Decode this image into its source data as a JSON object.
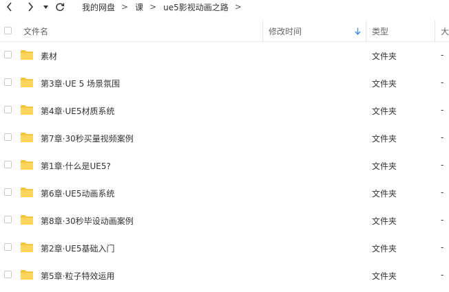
{
  "toolbar": {
    "back_icon": "chevron-left-icon",
    "forward_icon": "chevron-right-icon",
    "history_icon": "caret-down-icon",
    "refresh_icon": "refresh-icon"
  },
  "breadcrumb": {
    "items": [
      "我的网盘",
      "课",
      "ue5影视动画之路"
    ],
    "separator": ">"
  },
  "columns": {
    "name": "文件名",
    "modified": "修改时间",
    "type": "类型",
    "size": "大"
  },
  "sort": {
    "column": "modified",
    "direction": "descending",
    "icon": "sort-down-arrow-icon",
    "color": "#3b8cf7"
  },
  "folder_color": "#ffd45c",
  "files": [
    {
      "name": "素材",
      "type": "文件夹",
      "size": "-"
    },
    {
      "name": "第3章·UE 5 场景氛围",
      "type": "文件夹",
      "size": "-"
    },
    {
      "name": "第4章·UE5材质系统",
      "type": "文件夹",
      "size": "-"
    },
    {
      "name": "第7章·30秒买量视频案例",
      "type": "文件夹",
      "size": "-"
    },
    {
      "name": "第1章·什么是UE5?",
      "type": "文件夹",
      "size": "-"
    },
    {
      "name": "第6章·UE5动画系统",
      "type": "文件夹",
      "size": "-"
    },
    {
      "name": "第8章·30秒毕设动画案例",
      "type": "文件夹",
      "size": "-"
    },
    {
      "name": "第2章·UE5基础入门",
      "type": "文件夹",
      "size": "-"
    },
    {
      "name": "第5章·粒子特效运用",
      "type": "文件夹",
      "size": "-"
    }
  ]
}
